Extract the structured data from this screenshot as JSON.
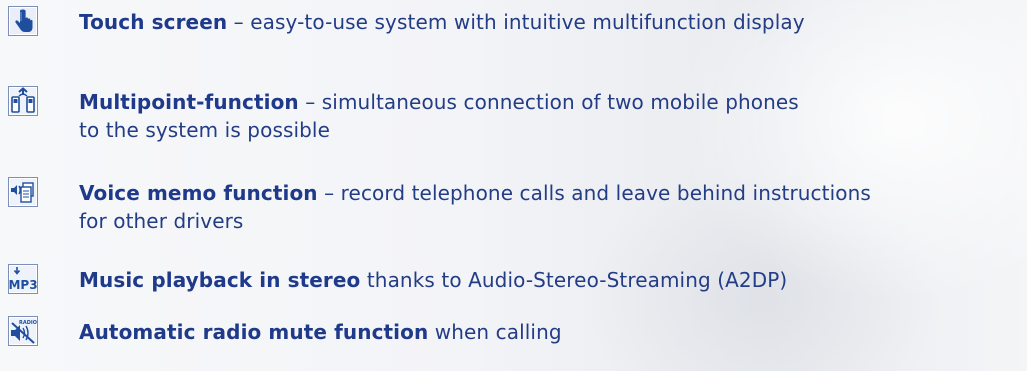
{
  "features": [
    {
      "icon": "touch-hand-icon",
      "title": "Touch screen",
      "line1": " – easy-to-use system with intuitive multifunction display",
      "line2": ""
    },
    {
      "icon": "two-phones-icon",
      "title": "Multipoint-function",
      "line1": " – simultaneous connection of two mobile phones",
      "line2": "to the system is possible"
    },
    {
      "icon": "voice-memo-icon",
      "title": "Voice memo function",
      "line1": " – record telephone calls and leave behind instructions",
      "line2": "for other drivers"
    },
    {
      "icon": "mp3-icon",
      "title": "Music playback in stereo",
      "line1": " thanks to Audio-Stereo-Streaming (A2DP)",
      "line2": ""
    },
    {
      "icon": "radio-mute-icon",
      "title": "Automatic radio mute function",
      "line1": " when calling",
      "line2": ""
    }
  ],
  "icon_labels": {
    "mp3": "MP3",
    "radio": "RADIO"
  },
  "colors": {
    "text": "#233c86",
    "icon_blue": "#1f4e9e",
    "icon_frame": "#6f86b8"
  }
}
